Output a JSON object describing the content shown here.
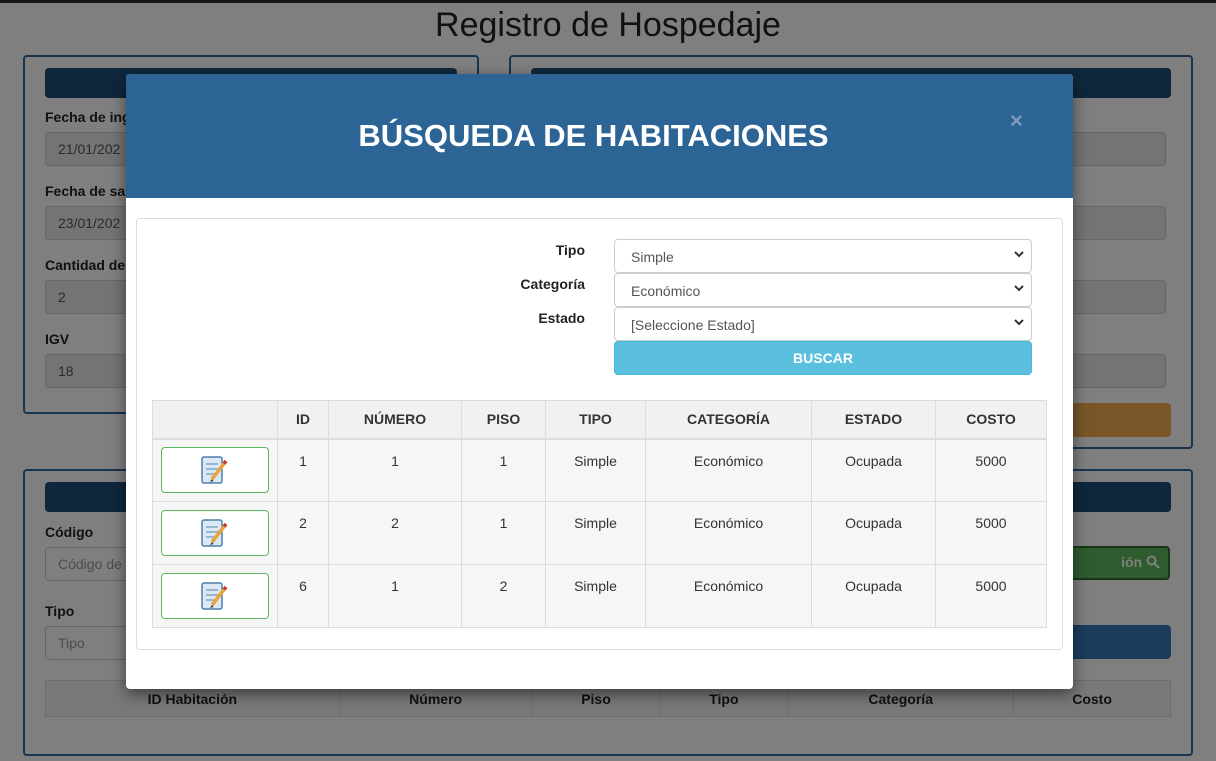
{
  "page": {
    "title": "Registro de Hospedaje",
    "left_panel": {
      "fields": [
        {
          "label": "Fecha de ing",
          "value": "21/01/202"
        },
        {
          "label": "Fecha de sa",
          "value": "23/01/202"
        },
        {
          "label": "Cantidad de",
          "value": "2"
        },
        {
          "label": "IGV",
          "value": "18"
        }
      ]
    },
    "lower_panel": {
      "codigo_label": "Código",
      "codigo_placeholder": "Código de",
      "tipo_label": "Tipo",
      "tipo_placeholder": "Tipo",
      "search_button_label": "ión",
      "table_headers": [
        "ID Habitación",
        "Número",
        "Piso",
        "Tipo",
        "Categoría",
        "Costo"
      ]
    }
  },
  "modal": {
    "title": "BÚSQUEDA DE HABITACIONES",
    "close_label": "×",
    "form": {
      "tipo_label": "Tipo",
      "tipo_value": "Simple",
      "categoria_label": "Categoría",
      "categoria_value": "Económico",
      "estado_label": "Estado",
      "estado_value": "[Seleccione Estado]",
      "buscar_label": "BUSCAR"
    },
    "table": {
      "headers": [
        "",
        "ID",
        "NÚMERO",
        "PISO",
        "TIPO",
        "CATEGORÍA",
        "ESTADO",
        "COSTO"
      ],
      "rows": [
        {
          "id": "1",
          "numero": "1",
          "piso": "1",
          "tipo": "Simple",
          "categoria": "Económico",
          "estado": "Ocupada",
          "costo": "5000"
        },
        {
          "id": "2",
          "numero": "2",
          "piso": "1",
          "tipo": "Simple",
          "categoria": "Económico",
          "estado": "Ocupada",
          "costo": "5000"
        },
        {
          "id": "6",
          "numero": "1",
          "piso": "2",
          "tipo": "Simple",
          "categoria": "Económico",
          "estado": "Ocupada",
          "costo": "5000"
        }
      ]
    }
  },
  "icons": {
    "edit": "edit-note-icon",
    "search": "search-icon",
    "select": "chevron-down-icon",
    "close": "close-icon"
  },
  "colors": {
    "header": "#2c6496",
    "buscar": "#5bc0de",
    "edit_border": "#5cb85c",
    "panel_border": "#2c6aa0",
    "orange": "#f0ad4e"
  }
}
